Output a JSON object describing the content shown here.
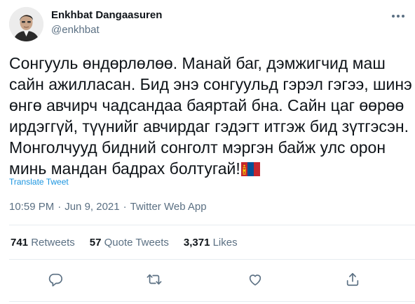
{
  "author": {
    "name": "Enkhbat Dangaasuren",
    "handle": "@enkhbat"
  },
  "tweet": {
    "text": "Сонгууль өндөрлөлөө. Манай баг, дэмжигчид маш\nсайн ажилласан. Бид энэ сонгуульд гэрэл гэгээ, шинэ\nөнгө авчирч чадсандаа баяртай бна. Сайн цаг өөрөө\nирдэггүй, түүнийг авчирдаг гэдэгт итгэж бид зүтгэсэн.\nМонголчууд бидний сонголт мэргэн байж улс орон\nминь мандан бадрах болтугай!",
    "emoji": "flag-mongolia",
    "translate_label": "Translate Tweet"
  },
  "meta": {
    "time": "10:59 PM",
    "date": "Jun 9, 2021",
    "source": "Twitter Web App",
    "separator": "·"
  },
  "stats": {
    "retweets": {
      "count": "741",
      "label": "Retweets"
    },
    "quotes": {
      "count": "57",
      "label": "Quote Tweets"
    },
    "likes": {
      "count": "3,371",
      "label": "Likes"
    }
  },
  "icons": {
    "more": "more-icon",
    "reply": "reply-icon",
    "retweet": "retweet-icon",
    "like": "heart-icon",
    "share": "share-icon"
  },
  "colors": {
    "text": "#0f1419",
    "secondary": "#5b7083",
    "link": "#1b95e0",
    "divider": "#e6ecf0",
    "flag_red": "#c4272f",
    "flag_blue": "#015197",
    "flag_gold": "#f9cf02"
  }
}
